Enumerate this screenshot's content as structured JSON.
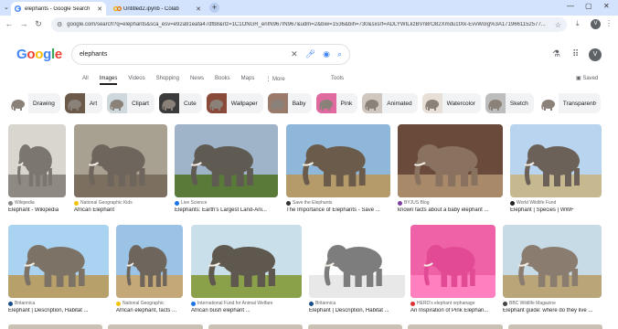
{
  "browser": {
    "tabs": [
      {
        "title": "elephants - Google Search",
        "favicon": "google-icon"
      },
      {
        "title": "Untitled2.ipynb - Colab",
        "favicon": "colab-icon"
      }
    ],
    "new_tab": "+",
    "url": "google.com/search?q=elephants&sca_esv=e92a91eafa47dfb8&rlz=1C1ONGR_enIN967IN967&udm=2&biw=1536&bih=730&sxsrf=ADLYWILkzBVn8rO82Xmdu1tXk-EvvWoIg%3A1719661152577..."
  },
  "header": {
    "logo": "Google",
    "query": "elephants",
    "avatar_letter": "V"
  },
  "nav": {
    "tabs": [
      "All",
      "Images",
      "Videos",
      "Shopping",
      "News",
      "Books",
      "Maps",
      "More"
    ],
    "active": "Images",
    "tools": "Tools",
    "saved": "Saved"
  },
  "chips": [
    "Drawing",
    "Art",
    "Clipart",
    "Cute",
    "Wallpaper",
    "Baby",
    "Pink",
    "Animated",
    "Watercolor",
    "Sketch",
    "Transparent"
  ],
  "results": [
    {
      "source": "Wikipedia",
      "caption": "Elephant - Wikipedia",
      "src_color": "#888888"
    },
    {
      "source": "National Geographic Kids",
      "caption": "African Elephant",
      "src_color": "#f4c20d"
    },
    {
      "source": "Live Science",
      "caption": "Elephants: Earth's Largest Land-Ani...",
      "src_color": "#1a73e8"
    },
    {
      "source": "Save the Elephants",
      "caption": "The Importance of Elephants - Save ...",
      "src_color": "#333333"
    },
    {
      "source": "BYJUS Blog",
      "caption": "known facts about a baby elephant ...",
      "src_color": "#7b3fa0"
    },
    {
      "source": "World Wildlife Fund",
      "caption": "Elephant | Species | WWF",
      "src_color": "#222222"
    },
    {
      "source": "Britannica",
      "caption": "Elephant | Description, Habitat ...",
      "src_color": "#1a4f8b"
    },
    {
      "source": "National Geographic",
      "caption": "African elephant, facts ...",
      "src_color": "#f4c20d"
    },
    {
      "source": "International Fund for Animal Welfare",
      "caption": "African bush elephant ...",
      "src_color": "#1a73e8"
    },
    {
      "source": "Britannica",
      "caption": "Elephant | Description, Habitat ...",
      "src_color": "#1a4f8b"
    },
    {
      "source": "HERD's elephant orphanage",
      "caption": "An Inspiration of Pink Elephan...",
      "src_color": "#d33"
    },
    {
      "source": "BBC Wildlife Magazine",
      "caption": "Elephant guide: where do they live ...",
      "src_color": "#444444"
    }
  ]
}
